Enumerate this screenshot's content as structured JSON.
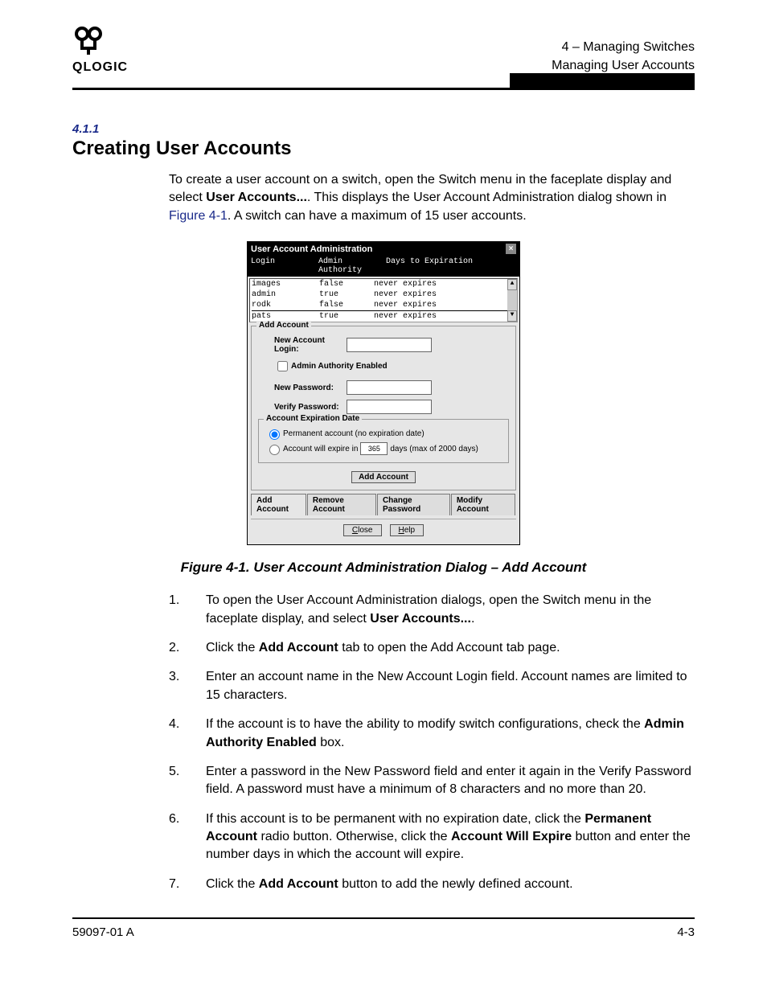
{
  "header": {
    "logo_text": "QLOGIC",
    "chapter_line": "4 – Managing Switches",
    "section_line": "Managing User Accounts"
  },
  "section": {
    "number": "4.1.1",
    "title": "Creating User Accounts"
  },
  "intro": {
    "p1a": "To create a user account on a switch, open the Switch menu in the faceplate display and select ",
    "p1b": "User Accounts...",
    "p1c": ". This displays the User Account Administration dialog shown in ",
    "p1link": "Figure 4-1",
    "p1d": ". A switch can have a maximum of 15 user accounts."
  },
  "dialog": {
    "title": "User Account Administration",
    "table": {
      "headers": [
        "Login",
        "Admin Authority",
        "Days to Expiration"
      ],
      "rows": [
        {
          "login": "images",
          "admin": "false",
          "exp": "never expires"
        },
        {
          "login": "admin",
          "admin": "true",
          "exp": "never expires"
        },
        {
          "login": "rodk",
          "admin": "false",
          "exp": "never expires"
        },
        {
          "login": "pats",
          "admin": "true",
          "exp": "never expires"
        }
      ]
    },
    "fieldset_legend": "Add Account",
    "labels": {
      "new_login": "New Account Login:",
      "admin_chk": "Admin Authority Enabled",
      "new_pass": "New Password:",
      "verify_pass": "Verify Password:"
    },
    "exp": {
      "legend": "Account Expiration Date",
      "opt_perm": "Permanent account (no expiration date)",
      "opt_expire_a": "Account will expire in",
      "opt_expire_days": "365",
      "opt_expire_b": "days (max of 2000 days)"
    },
    "add_btn": "Add Account",
    "tabs": [
      "Add Account",
      "Remove Account",
      "Change Password",
      "Modify Account"
    ],
    "close_btn_u": "C",
    "close_btn_r": "lose",
    "help_btn_u": "H",
    "help_btn_r": "elp"
  },
  "figure_caption": "Figure 4-1.  User Account Administration Dialog – Add Account",
  "steps": [
    {
      "n": "1.",
      "pre": "To open the User Account Administration dialogs, open the Switch menu in the faceplate display, and select ",
      "b": "User Accounts...",
      "post": "."
    },
    {
      "n": "2.",
      "pre": "Click the ",
      "b": "Add Account",
      "post": " tab to open the Add Account tab page."
    },
    {
      "n": "3.",
      "pre": "Enter an account name in the New Account Login field. Account names are limited to 15 characters.",
      "b": "",
      "post": ""
    },
    {
      "n": "4.",
      "pre": "If the account is to have the ability to modify switch configurations, check the ",
      "b": "Admin Authority Enabled",
      "post": " box."
    },
    {
      "n": "5.",
      "pre": "Enter a password in the New Password field and enter it again in the Verify Password field. A password must have a minimum of 8 characters and no more than 20.",
      "b": "",
      "post": ""
    },
    {
      "n": "6.",
      "pre": "If this account is to be permanent with no expiration date, click the ",
      "b": "Permanent Account",
      "mid": " radio button. Otherwise, click the ",
      "b2": "Account Will Expire",
      "post": " button and enter the number days in which the account will expire."
    },
    {
      "n": "7.",
      "pre": "Click the ",
      "b": "Add Account",
      "post": " button to add the newly defined account."
    }
  ],
  "footer": {
    "left": "59097-01 A",
    "right": "4-3"
  }
}
